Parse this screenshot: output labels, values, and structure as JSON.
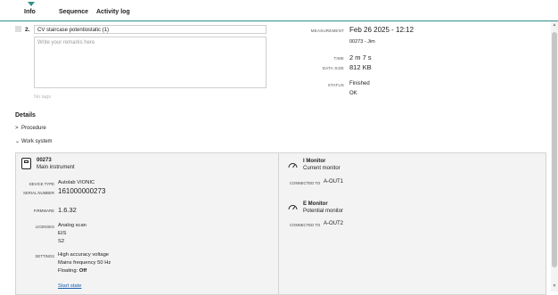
{
  "tabs": [
    {
      "label": "Info",
      "active": true
    },
    {
      "label": "Sequence",
      "active": false
    },
    {
      "label": "Activity log",
      "active": false
    }
  ],
  "item": {
    "number": "2.",
    "title": "CV staircase potentiostatic (1)",
    "remarks_placeholder": "Write your remarks here",
    "tags_text": "No tags"
  },
  "meta": {
    "measurement_label": "Measurement",
    "measurement_value": "Feb 26 2025 - 12:12",
    "measurement_sub": "00273 - Jim",
    "time_label": "Time",
    "time_value": "2 m 7 s",
    "datasize_label": "Data size",
    "datasize_value": "812 KB",
    "status_label": "Status",
    "status_value": "Finished",
    "status_sub": "OK"
  },
  "details": {
    "heading": "Details",
    "procedure_label": "Procedure",
    "worksystem_label": "Work system"
  },
  "instrument": {
    "id": "00273",
    "role": "Main instrument",
    "device_type_label": "Device type",
    "device_type_value": "Autolab VIONIC",
    "serial_label": "Serial number",
    "serial_value": "161000000273",
    "firmware_label": "Firmware",
    "firmware_value": "1.6.32",
    "licenses_label": "Licenses",
    "licenses": [
      "Analog scan",
      "EIS",
      "S2"
    ],
    "settings_label": "Settings",
    "settings": [
      "High accuracy voltage",
      "Mains frequency 50 Hz"
    ],
    "floating_label": "Floating:",
    "floating_value": "Off",
    "start_state_link": "Start state"
  },
  "monitors": [
    {
      "name": "I Monitor",
      "desc": "Current monitor",
      "connected_label": "Connected to",
      "connected_value": "A-OUT1"
    },
    {
      "name": "E Monitor",
      "desc": "Potential monitor",
      "connected_label": "Connected to",
      "connected_value": "A-OUT2"
    }
  ],
  "colors": {
    "accent": "#2f8f87",
    "link": "#1a5fb4"
  },
  "icons": [
    "drag-handle-icon",
    "instrument-icon",
    "gauge-icon",
    "chevron-right-icon",
    "chevron-down-icon"
  ]
}
